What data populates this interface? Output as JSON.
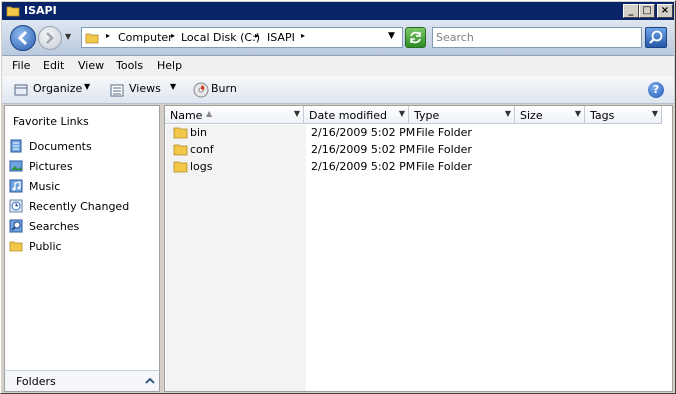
{
  "window": {
    "title": "ISAPI"
  },
  "address": {
    "segments": [
      "Computer",
      "Local Disk (C:)",
      "ISAPI"
    ]
  },
  "search": {
    "placeholder": "Search"
  },
  "menu": [
    "File",
    "Edit",
    "View",
    "Tools",
    "Help"
  ],
  "toolbar": {
    "organize": "Organize",
    "views": "Views",
    "burn": "Burn"
  },
  "nav": {
    "header": "Favorite Links",
    "items": [
      {
        "label": "Documents",
        "icon": "documents-icon"
      },
      {
        "label": "Pictures",
        "icon": "pictures-icon"
      },
      {
        "label": "Music",
        "icon": "music-icon"
      },
      {
        "label": "Recently Changed",
        "icon": "recently-changed-icon"
      },
      {
        "label": "Searches",
        "icon": "searches-icon"
      },
      {
        "label": "Public",
        "icon": "folder-icon"
      }
    ],
    "folders_label": "Folders"
  },
  "columns": [
    "Name",
    "Date modified",
    "Type",
    "Size",
    "Tags"
  ],
  "files": [
    {
      "name": "bin",
      "date": "2/16/2009 5:02 PM",
      "type": "File Folder"
    },
    {
      "name": "conf",
      "date": "2/16/2009 5:02 PM",
      "type": "File Folder"
    },
    {
      "name": "logs",
      "date": "2/16/2009 5:02 PM",
      "type": "File Folder"
    }
  ],
  "colors": {
    "titlebar": "#0a246a",
    "accent": "#3a70c0",
    "folder": "#f3c84a"
  }
}
